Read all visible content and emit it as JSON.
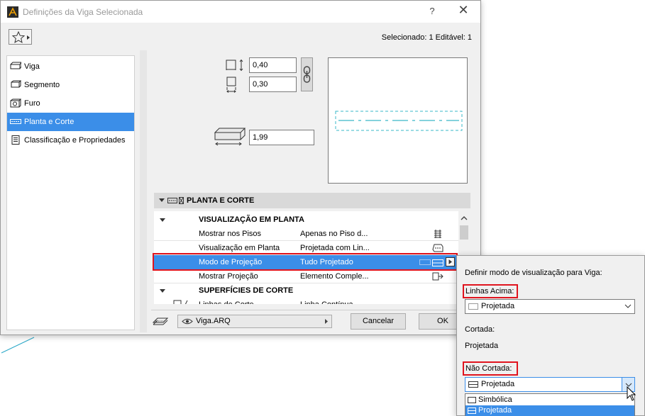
{
  "dialog": {
    "title": "Definições da Viga Selecionada",
    "help_label": "?",
    "close_label": "✕",
    "selection_info": "Selecionado: 1 Editável: 1"
  },
  "nav": {
    "items": [
      {
        "label": "Viga",
        "icon": "beam-icon"
      },
      {
        "label": "Segmento",
        "icon": "segment-icon"
      },
      {
        "label": "Furo",
        "icon": "hole-icon"
      },
      {
        "label": "Planta e Corte",
        "icon": "floor-plan-section-icon",
        "active": true
      },
      {
        "label": "Classificação e Propriedades",
        "icon": "document-icon"
      }
    ]
  },
  "geometry": {
    "height_value": "0,40",
    "width_value": "0,30",
    "offset_value": "1,99"
  },
  "section": {
    "header": "PLANTA E CORTE",
    "group1": "VISUALIZAÇÃO EM PLANTA",
    "rows": [
      {
        "name": "Mostrar nos Pisos",
        "value": "Apenas no Piso d..."
      },
      {
        "name": "Visualização em Planta",
        "value": "Projetada com Lin..."
      },
      {
        "name": "Modo de Projeção",
        "value": "Tudo Projetado",
        "selected": true
      },
      {
        "name": "Mostrar Projeção",
        "value": "Elemento Comple..."
      }
    ],
    "group2": "SUPERFÍCIES DE CORTE",
    "partial_row": {
      "name": "Linhas de Corte",
      "value": "Linha Contínua"
    }
  },
  "footer": {
    "view_value": "Viga.ARQ",
    "cancel_label": "Cancelar",
    "ok_label": "OK"
  },
  "popover": {
    "title": "Definir modo de visualização para Viga:",
    "linhas_acima_label": "Linhas Acima:",
    "linhas_acima_value": "Projetada",
    "cortada_label": "Cortada:",
    "cortada_value": "Projetada",
    "nao_cortada_label": "Não Cortada:",
    "nao_cortada_value": "Projetada",
    "options": [
      "Simbólica",
      "Projetada"
    ],
    "selected_option": "Projetada"
  },
  "colors": {
    "selection": "#3b8ee8",
    "highlight": "#e0141e",
    "preview_line": "#3ab8c8"
  }
}
